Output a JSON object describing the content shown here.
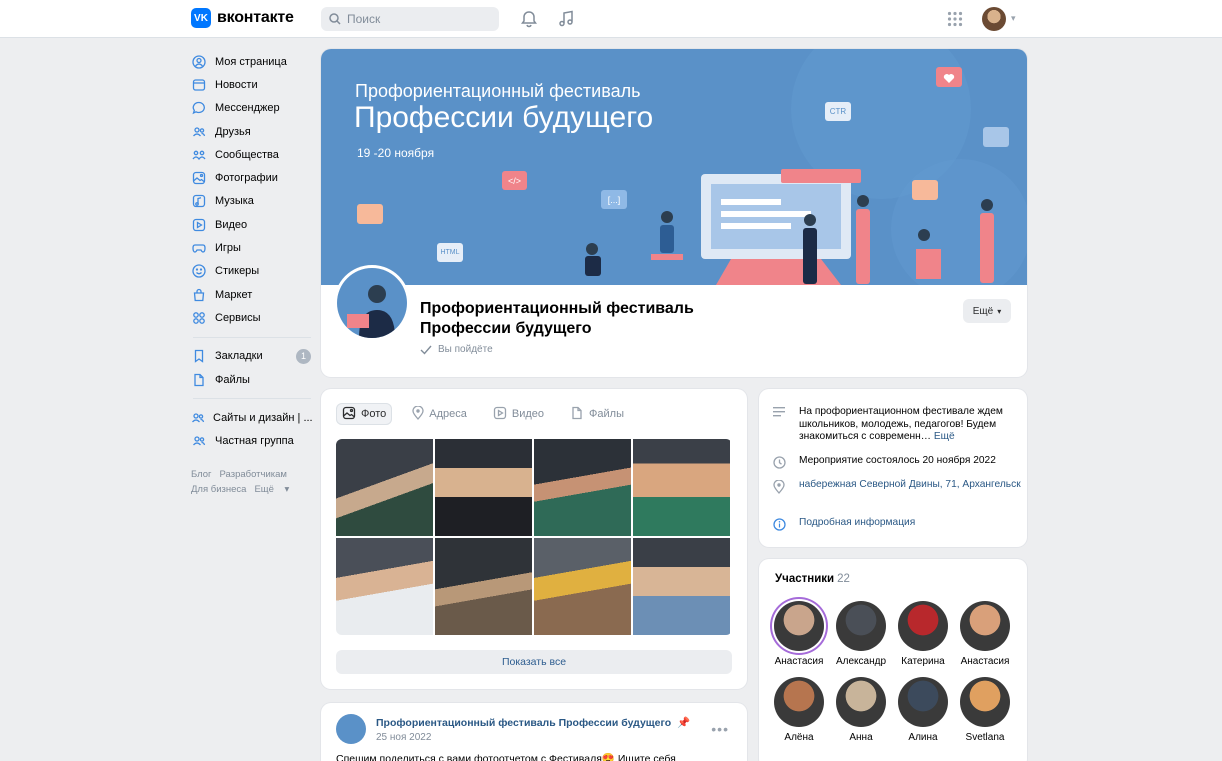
{
  "header": {
    "logo_text": "вконтакте",
    "logo_mark": "VK",
    "search_placeholder": "Поиск",
    "icons": [
      "bell-icon",
      "music-note-icon",
      "apps-grid-icon",
      "chevron-down-icon"
    ]
  },
  "sidebar": {
    "items": [
      {
        "label": "Моя страница",
        "icon": "user-circle-icon"
      },
      {
        "label": "Новости",
        "icon": "news-icon"
      },
      {
        "label": "Мессенджер",
        "icon": "message-icon"
      },
      {
        "label": "Друзья",
        "icon": "users-icon"
      },
      {
        "label": "Сообщества",
        "icon": "community-icon"
      },
      {
        "label": "Фотографии",
        "icon": "photo-icon"
      },
      {
        "label": "Музыка",
        "icon": "music-icon"
      },
      {
        "label": "Видео",
        "icon": "video-icon"
      },
      {
        "label": "Игры",
        "icon": "gamepad-icon"
      },
      {
        "label": "Стикеры",
        "icon": "smile-icon"
      },
      {
        "label": "Маркет",
        "icon": "bag-icon"
      },
      {
        "label": "Сервисы",
        "icon": "services-icon"
      }
    ],
    "items2": [
      {
        "label": "Закладки",
        "icon": "bookmark-icon",
        "badge": "1"
      },
      {
        "label": "Файлы",
        "icon": "file-icon"
      }
    ],
    "items3": [
      {
        "label": "Сайты и дизайн | ...",
        "icon": "users-icon"
      },
      {
        "label": "Частная группа",
        "icon": "users-icon"
      }
    ],
    "footer": {
      "blog": "Блог",
      "dev": "Разработчикам",
      "business": "Для бизнеса",
      "more": "Ещё"
    }
  },
  "cover": {
    "subtitle": "Профориентационный фестиваль",
    "title": "Профессии будущего",
    "dates": "19 -20 ноября",
    "chips": {
      "code": "</>",
      "brackets": "[...]",
      "html": "HTML",
      "ctr": "CTR"
    }
  },
  "group": {
    "name_line1": "Профориентационный фестиваль",
    "name_line2": "Профессии будущего",
    "status": "Вы пойдёте",
    "more_button": "Ещё"
  },
  "media": {
    "tabs": [
      {
        "label": "Фото",
        "icon": "photo-icon",
        "active": true
      },
      {
        "label": "Адреса",
        "icon": "location-pin-icon"
      },
      {
        "label": "Видео",
        "icon": "video-icon"
      },
      {
        "label": "Файлы",
        "icon": "file-icon"
      }
    ],
    "photo_count": 8,
    "show_all": "Показать все"
  },
  "info": {
    "description": "На профориентационном фестивале ждем школьников, молодежь, педагогов! Будем знакомиться с современн…",
    "description_more": "Ещё",
    "event_date": "Мероприятие состоялось 20 ноября 2022",
    "address": "набережная Северной Двины, 71, Архангельск",
    "details_link": "Подробная информация"
  },
  "members": {
    "title": "Участники",
    "count": "22",
    "list": [
      {
        "name": "Анастасия",
        "color": "#c9a58c"
      },
      {
        "name": "Александр",
        "color": "#4a4f57"
      },
      {
        "name": "Катерина",
        "color": "#b8282c"
      },
      {
        "name": "Анастасия",
        "color": "#d9a07a"
      },
      {
        "name": "Алёна",
        "color": "#b6754f"
      },
      {
        "name": "Анна",
        "color": "#c8b49a"
      },
      {
        "name": "Алина",
        "color": "#3c4a5c"
      },
      {
        "name": "Svetlana",
        "color": "#e0a060"
      }
    ]
  },
  "post": {
    "author": "Профориентационный фестиваль Профессии будущего",
    "date": "25 ноя 2022",
    "text": "Спешим поделиться с вами фотоотчетом с Фестиваля😍 Ищите себя"
  }
}
